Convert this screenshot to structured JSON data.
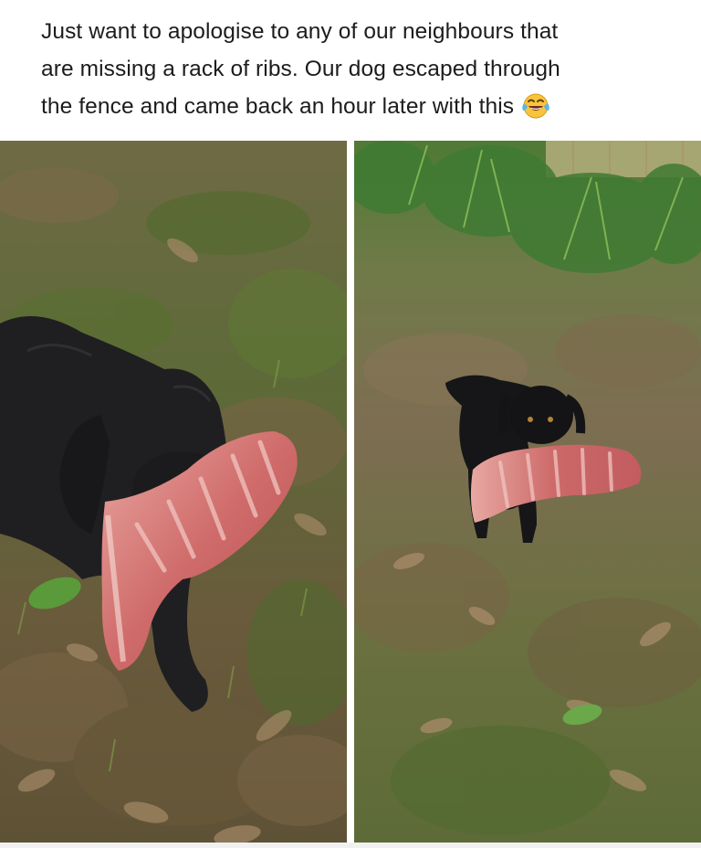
{
  "post": {
    "text_lines": [
      "Just want to apologise to any of our neighbours that",
      "are missing a rack of ribs. Our dog escaped through",
      "the fence and came back an hour later with this"
    ],
    "emoji": "face-with-tears-of-joy"
  },
  "photos": [
    {
      "subject": "black dog holding raw rack of ribs, close-up"
    },
    {
      "subject": "black dog carrying raw rack of ribs across yard"
    }
  ]
}
